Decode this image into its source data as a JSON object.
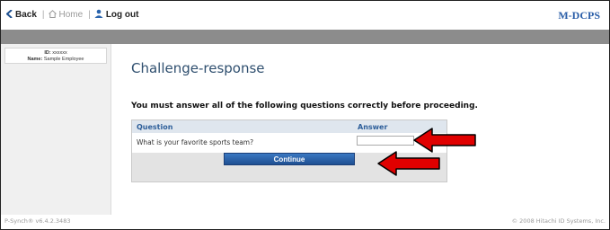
{
  "nav": {
    "back_label": "Back",
    "home_label": "Home",
    "logout_label": "Log out"
  },
  "brand": "M-DCPS",
  "user": {
    "id_label": "ID:",
    "id_value": "xxxxxx",
    "name_label": "Name:",
    "name_value": "Sample Employee"
  },
  "page": {
    "title": "Challenge-response",
    "instruction": "You must answer all of the following questions correctly before proceeding."
  },
  "table": {
    "question_header": "Question",
    "answer_header": "Answer",
    "rows": [
      {
        "question": "What is your favorite sports team?",
        "answer": ""
      }
    ]
  },
  "actions": {
    "continue_label": "Continue"
  },
  "footer": {
    "version": "P-Synch® v6.4.2.3483",
    "copyright": "© 2008 Hitachi ID Systems, Inc."
  },
  "colors": {
    "accent": "#2e5f9a",
    "button": "#2a64ad",
    "arrow": "#e00000"
  },
  "icons": {
    "back": "chevron-left-icon",
    "home": "home-icon",
    "logout": "user-icon"
  }
}
